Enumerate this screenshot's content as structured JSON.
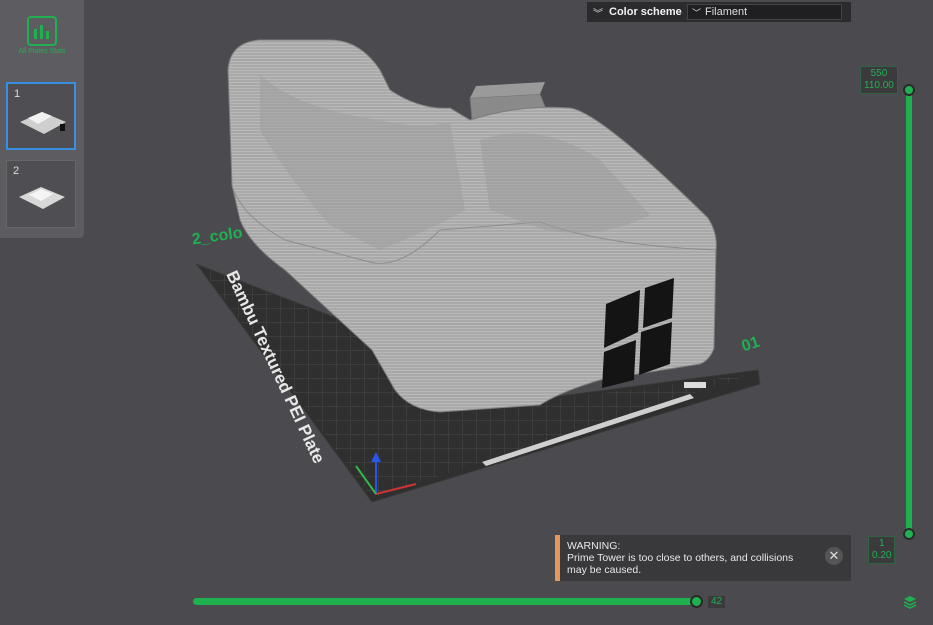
{
  "plates": {
    "all_label": "All Plates Stats",
    "items": [
      {
        "number": "1"
      },
      {
        "number": "2"
      }
    ]
  },
  "scene": {
    "plate_name": "2_colo",
    "plate_number": "01",
    "bed_text": "Bambu Textured PEI Plate"
  },
  "color_scheme": {
    "label": "Color scheme",
    "value": "Filament"
  },
  "layer_slider": {
    "top_layer": "550",
    "top_height": "110.00",
    "bottom_layer": "1",
    "bottom_height": "0.20"
  },
  "move_slider": {
    "value": "42"
  },
  "warning": {
    "title": "WARNING:",
    "message": "Prime Tower is too close to others, and collisions may be caused."
  },
  "colors": {
    "accent": "#1fb14f",
    "warning": "#e8955a",
    "selection": "#3a8fe0"
  }
}
